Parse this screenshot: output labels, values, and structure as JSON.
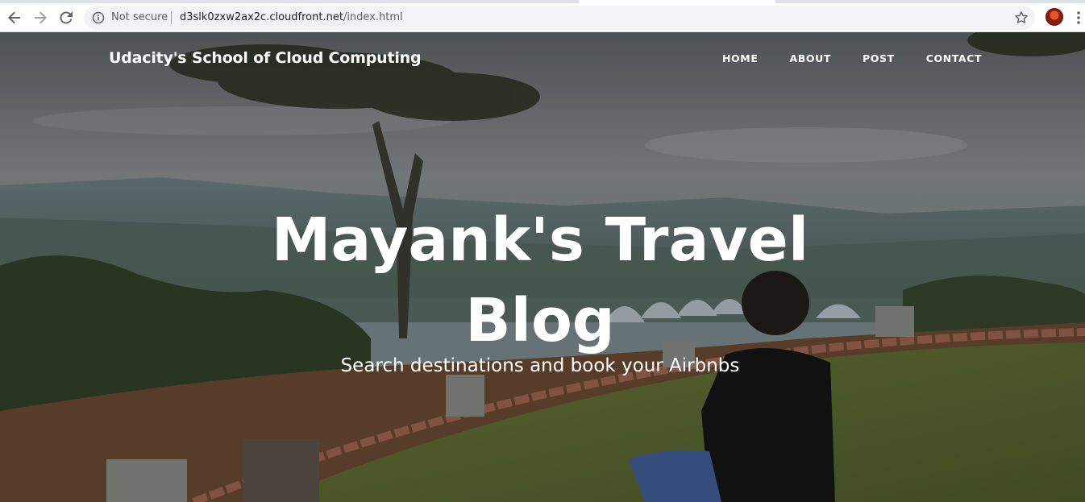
{
  "browser": {
    "security_label": "Not secure",
    "url_host": "d3slk0zxw2ax2c.cloudfront.net",
    "url_path": "/index.html",
    "icons": [
      "back-icon",
      "forward-icon",
      "reload-icon",
      "info-icon",
      "star-icon",
      "profile-avatar",
      "menu-icon"
    ]
  },
  "site": {
    "brand": "Udacity's School of Cloud Computing",
    "nav": [
      {
        "label": "HOME"
      },
      {
        "label": "ABOUT"
      },
      {
        "label": "POST"
      },
      {
        "label": "CONTACT"
      }
    ]
  },
  "hero": {
    "title_line1": "Mayank's Travel",
    "title_line2": "Blog",
    "subtitle": "Search destinations and book your Airbnbs"
  },
  "colors": {
    "hero_text": "#ffffff",
    "omnibox_bg": "#f1f3f4"
  }
}
